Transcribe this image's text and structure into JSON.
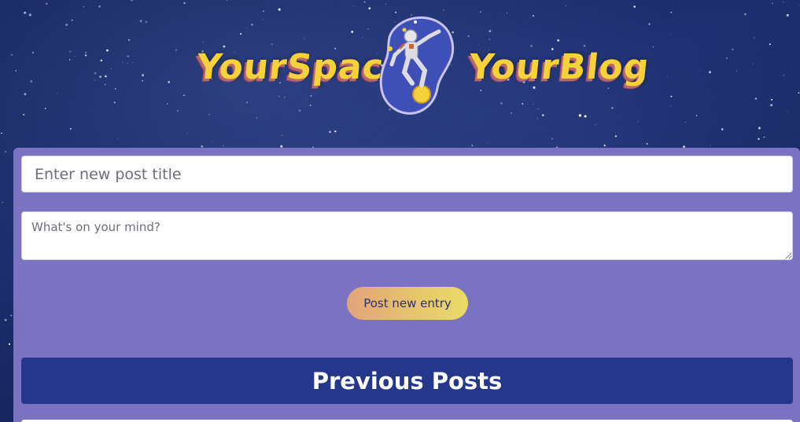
{
  "brand": {
    "left_word": "YourSpace",
    "right_word": "YourBlog",
    "logo_icon": "astronaut-icon",
    "logo_color": "#f6d23a"
  },
  "composer": {
    "title_placeholder": "Enter new post title",
    "body_placeholder": "What's on your mind?",
    "submit_label": "Post new entry"
  },
  "posts": {
    "heading": "Previous Posts"
  },
  "colors": {
    "panel": "#7b73c1",
    "heading_bar": "#25378a",
    "button_gradient_start": "#e3a37b",
    "button_gradient_end": "#eadb68"
  }
}
